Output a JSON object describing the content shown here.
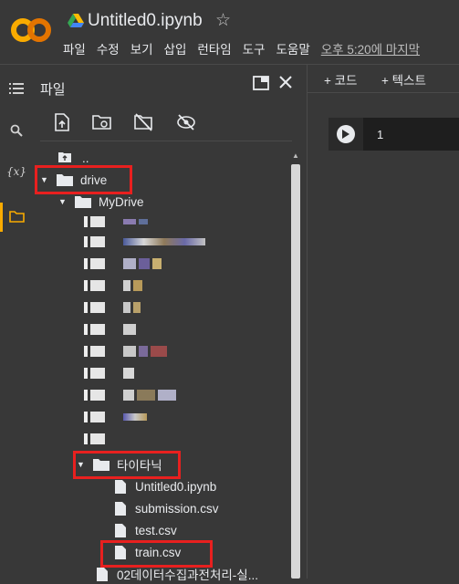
{
  "header": {
    "title": "Untitled0.ipynb",
    "menu": [
      "파일",
      "수정",
      "보기",
      "삽입",
      "런타임",
      "도구",
      "도움말"
    ],
    "last_edit": "오후 5:20에 마지막"
  },
  "rail": {
    "icons": [
      "menu-icon",
      "search-icon",
      "variables-icon",
      "folder-icon"
    ],
    "variables_glyph": "{x}"
  },
  "files_panel": {
    "title": "파일",
    "toolbar": [
      "upload-icon",
      "refresh-folder-icon",
      "hide-drive-icon",
      "hide-files-icon"
    ],
    "tree": {
      "parent": "..",
      "drive": "drive",
      "mydrive": "MyDrive",
      "titanic_folder": "타이타닉",
      "titanic_files": [
        "Untitled0.ipynb",
        "submission.csv",
        "test.csv",
        "train.csv"
      ],
      "last_item": "02데이터수집과전처리-실..."
    }
  },
  "notebook": {
    "add_code": "+ 코드",
    "add_text": "+ 텍스트",
    "cell_number": "1"
  },
  "colors": {
    "background": "#383838",
    "accent_orange": "#f9ab00",
    "highlight_red": "#e8201f"
  }
}
